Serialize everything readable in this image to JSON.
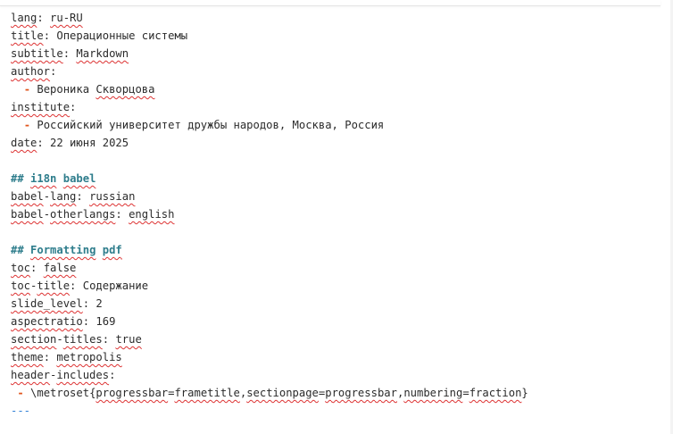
{
  "yaml": {
    "lang": {
      "key": "lang",
      "value": "ru-RU"
    },
    "title": {
      "key": "title",
      "value": "Операционные системы"
    },
    "subtitle": {
      "key": "subtitle",
      "value": "Markdown"
    },
    "author": {
      "key": "author",
      "item_first": "Вероника ",
      "item_last": "Скворцова"
    },
    "institute": {
      "key": "institute",
      "item": "Российский университет дружбы народов, Москва, Россия"
    },
    "date": {
      "key": "date",
      "value": "22 июня 2025"
    },
    "section_babel": {
      "hash": "##",
      "word1": "i18n",
      "word2": "babel"
    },
    "babel_lang": {
      "key_a": "babel",
      "key_b": "lang",
      "value": "russian"
    },
    "babel_otherlangs": {
      "key_a": "babel",
      "key_b": "otherlangs",
      "value": "english"
    },
    "section_pdf": {
      "hash": "##",
      "word1": "Formatting",
      "word2": "pdf"
    },
    "toc": {
      "key": "toc",
      "value": "false"
    },
    "toc_title": {
      "key_a": "toc",
      "key_b": "title",
      "value": "Содержание"
    },
    "slide_level": {
      "key": "slide_level",
      "value": "2"
    },
    "aspectratio": {
      "key": "aspectratio",
      "value": "169"
    },
    "section_titles": {
      "key_a": "section",
      "key_b": "titles",
      "value": "true"
    },
    "theme": {
      "key": "theme",
      "value": "metropolis"
    },
    "header_includes": {
      "key_a": "header",
      "key_b": "includes",
      "cmd": "\\metroset{",
      "k1": "progressbar",
      "v1": "frametitle",
      "k2": "sectionpage",
      "v2": "progressbar",
      "k3": "numbering",
      "v3": "fraction",
      "close": "}"
    },
    "fence": "---"
  },
  "colors": {
    "heading": "#2e7d8c",
    "list_dash": "#e0551c",
    "fence": "#2f7fd6",
    "spellcheck": "#dd3333"
  }
}
